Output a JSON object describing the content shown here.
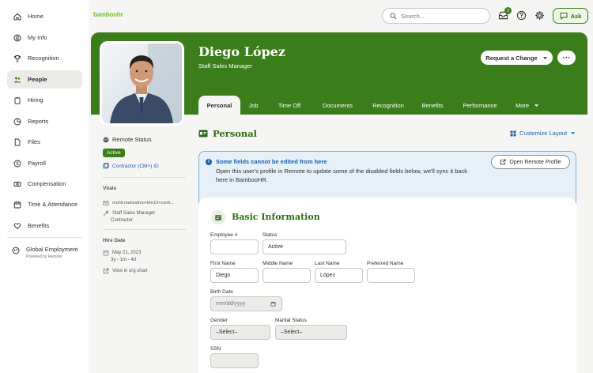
{
  "sidebar": {
    "items": [
      {
        "label": "Home",
        "icon": "home-icon"
      },
      {
        "label": "My Info",
        "icon": "person-icon"
      },
      {
        "label": "Recognition",
        "icon": "trophy-icon"
      },
      {
        "label": "People",
        "icon": "people-icon"
      },
      {
        "label": "Hiring",
        "icon": "clipboard-icon"
      },
      {
        "label": "Reports",
        "icon": "chart-icon"
      },
      {
        "label": "Files",
        "icon": "file-icon"
      },
      {
        "label": "Payroll",
        "icon": "dollar-icon"
      },
      {
        "label": "Compensation",
        "icon": "money-icon"
      },
      {
        "label": "Time & Attendance",
        "icon": "calendar-icon"
      },
      {
        "label": "Benefits",
        "icon": "heart-icon"
      }
    ],
    "global_employment": {
      "label": "Global Employment",
      "powered": "Powered by Remote"
    }
  },
  "topbar": {
    "logo": "bamboohr",
    "search_placeholder": "Search...",
    "inbox_badge": "3",
    "ask_label": "Ask"
  },
  "header": {
    "name": "Diego López",
    "title": "Staff Sales Manager",
    "request_change": "Request a Change",
    "more": "···"
  },
  "tabs": [
    {
      "label": "Personal",
      "active": true
    },
    {
      "label": "Job"
    },
    {
      "label": "Time Off"
    },
    {
      "label": "Documents"
    },
    {
      "label": "Recognition"
    },
    {
      "label": "Benefits"
    },
    {
      "label": "Performance"
    },
    {
      "label": "More"
    }
  ],
  "left": {
    "remote_status": "Remote Status",
    "active": "Active",
    "contractor_id": "Contractor (CM+) ID",
    "vitals": "Vitals",
    "email": "mohit.mahindroo+bhr10+contr...",
    "role": "Staff Sales Manager",
    "type": "Contractor",
    "hire_date_label": "Hire Date",
    "hire_date": "May 21, 2023",
    "tenure": "3y - 1m - 4d",
    "org_chart": "View in org chart"
  },
  "section": {
    "title": "Personal",
    "customize": "Customize Layout"
  },
  "info": {
    "title": "Some fields cannot be edited from here",
    "body": "Open this user's profile in Remote to update some of the disabled fields below, we'll sync it back here in BambooHR.",
    "button": "Open Remote Profile"
  },
  "basic": {
    "title": "Basic Information",
    "employee_no_label": "Employee #",
    "employee_no": "",
    "status_label": "Status",
    "status": "Active",
    "first_name_label": "First Name",
    "first_name": "Diego",
    "middle_name_label": "Middle Name",
    "middle_name": "",
    "last_name_label": "Last Name",
    "last_name": "López",
    "preferred_name_label": "Preferred Name",
    "preferred_name": "",
    "birth_date_label": "Birth Date",
    "birth_date_placeholder": "mm/dd/yyyy",
    "gender_label": "Gender",
    "gender": "–Select–",
    "marital_label": "Marital Status",
    "marital": "–Select–",
    "ssn_label": "SSN",
    "ssn": ""
  },
  "colors": {
    "brand": "#3b7d1a",
    "link": "#1b5fad",
    "info_bg": "#e6f0f8"
  }
}
